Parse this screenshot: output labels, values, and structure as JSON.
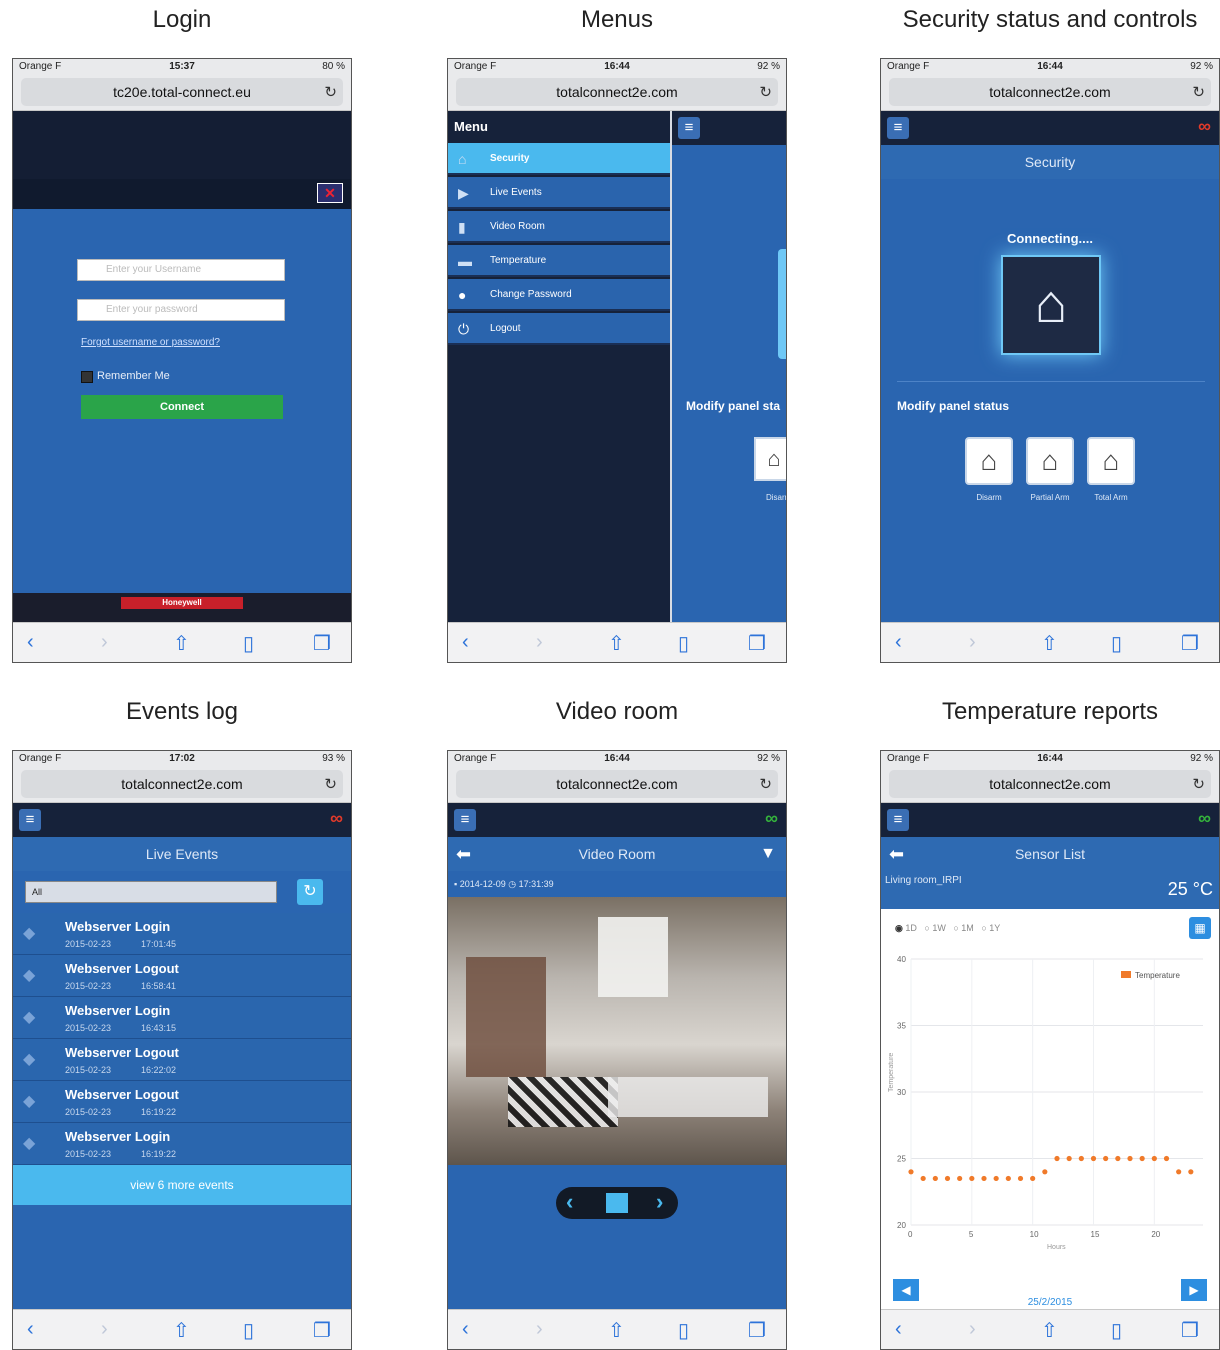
{
  "panels": [
    {
      "title": "Login"
    },
    {
      "title": "Menus"
    },
    {
      "title": "Security status and controls"
    },
    {
      "title": "Events log"
    },
    {
      "title": "Video room"
    },
    {
      "title": "Temperature reports"
    }
  ],
  "login": {
    "carrier": "Orange F",
    "time": "15:37",
    "battery": "80 %",
    "url": "tc20e.total-connect.eu",
    "username_placeholder": "Enter your Username",
    "password_placeholder": "Enter your password",
    "forgot_link": "Forgot username or password?",
    "remember_label": "Remember Me",
    "connect_label": "Connect",
    "brand": "Honeywell"
  },
  "menus": {
    "carrier": "Orange F",
    "time": "16:44",
    "battery": "92 %",
    "url": "totalconnect2e.com",
    "menu_header": "Menu",
    "items": [
      "Security",
      "Live Events",
      "Video Room",
      "Temperature",
      "Change Password",
      "Logout"
    ],
    "peek_text": "Modify panel sta",
    "peek_label": "Disarm"
  },
  "security": {
    "carrier": "Orange F",
    "time": "16:44",
    "battery": "92 %",
    "url": "totalconnect2e.com",
    "title": "Security",
    "connecting": "Connecting....",
    "modify_label": "Modify panel status",
    "buttons": [
      "Disarm",
      "Partial Arm",
      "Total Arm"
    ],
    "link_color": "#e23a2a"
  },
  "events": {
    "carrier": "Orange F",
    "time": "17:02",
    "battery": "93 %",
    "url": "totalconnect2e.com",
    "title": "Live Events",
    "filter": "All",
    "items": [
      {
        "title": "Webserver Login",
        "date": "2015-02-23",
        "time": "17:01:45"
      },
      {
        "title": "Webserver Logout",
        "date": "2015-02-23",
        "time": "16:58:41"
      },
      {
        "title": "Webserver Login",
        "date": "2015-02-23",
        "time": "16:43:15"
      },
      {
        "title": "Webserver Logout",
        "date": "2015-02-23",
        "time": "16:22:02"
      },
      {
        "title": "Webserver Logout",
        "date": "2015-02-23",
        "time": "16:19:22"
      },
      {
        "title": "Webserver Login",
        "date": "2015-02-23",
        "time": "16:19:22"
      }
    ],
    "more_label": "view 6 more events"
  },
  "video": {
    "carrier": "Orange F",
    "time": "16:44",
    "battery": "92 %",
    "url": "totalconnect2e.com",
    "title": "Video Room",
    "date": "2014-12-09",
    "clock": "17:31:39",
    "link_color": "#35b43c"
  },
  "temperature": {
    "carrier": "Orange F",
    "time": "16:44",
    "battery": "92 %",
    "url": "totalconnect2e.com",
    "title": "Sensor List",
    "sensor": "Living room_IRPI",
    "value": "25 °C",
    "ranges": [
      "1D",
      "1W",
      "1M",
      "1Y"
    ],
    "date": "25/2/2015",
    "chart_data": {
      "type": "scatter",
      "title": "",
      "xlabel": "Hours",
      "ylabel": "Temperature",
      "xlim": [
        0,
        24
      ],
      "ylim": [
        20,
        40
      ],
      "xticks": [
        0,
        5,
        10,
        15,
        20
      ],
      "yticks": [
        20,
        25,
        30,
        35,
        40
      ],
      "series": [
        {
          "name": "Temperature",
          "color": "#f07a2a",
          "x": [
            0,
            1,
            2,
            3,
            4,
            5,
            6,
            7,
            8,
            9,
            10,
            11,
            12,
            13,
            14,
            15,
            16,
            17,
            18,
            19,
            20,
            21,
            22,
            23
          ],
          "y": [
            24,
            23.5,
            23.5,
            23.5,
            23.5,
            23.5,
            23.5,
            23.5,
            23.5,
            23.5,
            23.5,
            24,
            25,
            25,
            25,
            25,
            25,
            25,
            25,
            25,
            25,
            25,
            24,
            24
          ]
        }
      ],
      "legend": "top-right",
      "grid": true
    }
  }
}
